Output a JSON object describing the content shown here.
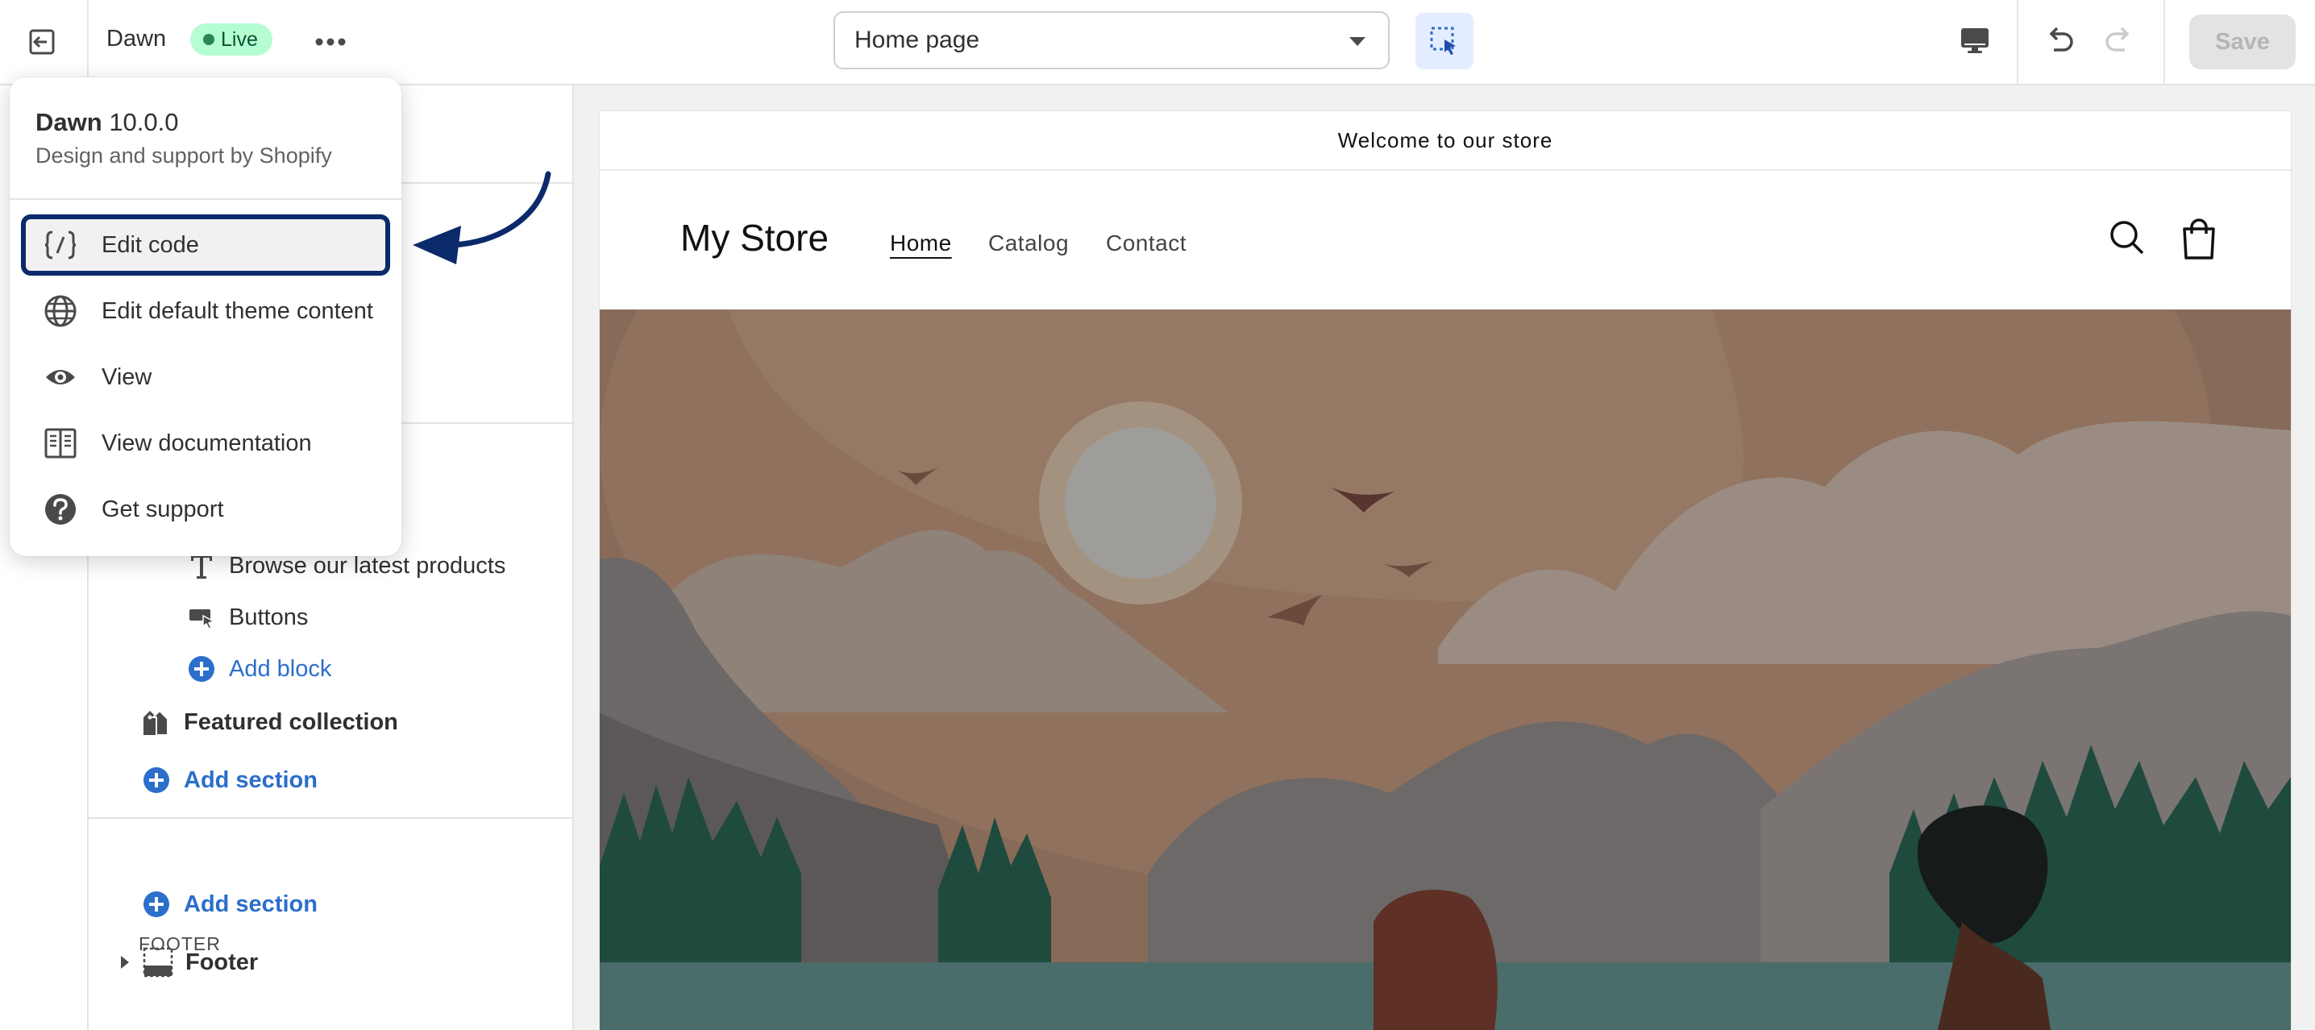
{
  "topbar": {
    "theme_name": "Dawn",
    "status_badge": "Live",
    "page_selector_value": "Home page",
    "save_label": "Save"
  },
  "popover": {
    "theme_title": "Dawn",
    "theme_version": "10.0.0",
    "theme_subtitle": "Design and support by Shopify",
    "items": [
      {
        "label": "Edit code",
        "icon": "code-icon"
      },
      {
        "label": "Edit default theme content",
        "icon": "globe-icon"
      },
      {
        "label": "View",
        "icon": "eye-icon"
      },
      {
        "label": "View documentation",
        "icon": "book-icon"
      },
      {
        "label": "Get support",
        "icon": "question-icon"
      }
    ]
  },
  "sidebar": {
    "blocks": [
      {
        "label": "Browse our latest products",
        "icon": "text-icon"
      },
      {
        "label": "Buttons",
        "icon": "button-icon"
      }
    ],
    "add_block_label": "Add block",
    "featured_collection_label": "Featured collection",
    "add_section_label": "Add section",
    "footer_heading": "FOOTER",
    "footer_add_section_label": "Add section",
    "footer_label": "Footer"
  },
  "preview": {
    "announcement": "Welcome to our store",
    "store_name": "My Store",
    "nav": [
      "Home",
      "Catalog",
      "Contact"
    ]
  },
  "colors": {
    "accent_blue": "#2c6ecb",
    "highlight_border": "#0b2a6b",
    "live_badge_bg": "#b4fed2",
    "save_disabled_bg": "#e3e3e3"
  }
}
